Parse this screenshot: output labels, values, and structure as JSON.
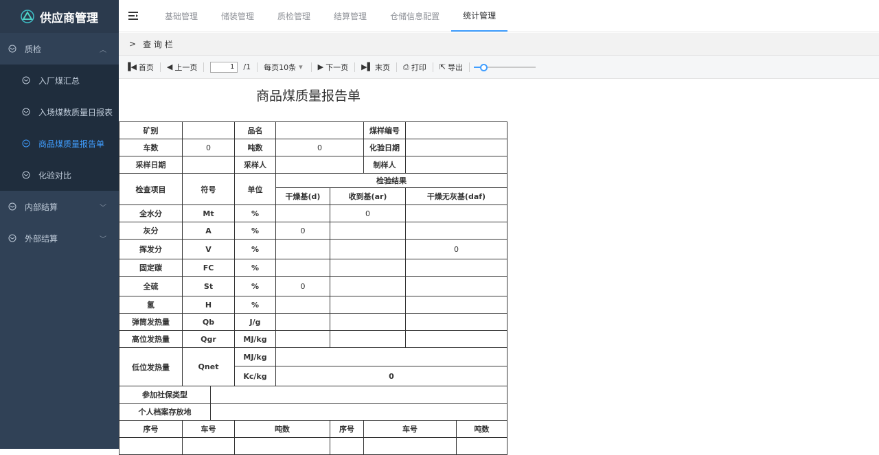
{
  "sidebar": {
    "app_title": "供应商管理",
    "groups": [
      {
        "label": "质检",
        "expanded": true,
        "items": [
          {
            "label": "入厂煤汇总"
          },
          {
            "label": "入场煤数质量日报表"
          },
          {
            "label": "商品煤质量报告单",
            "active": true
          },
          {
            "label": "化验对比"
          }
        ]
      },
      {
        "label": "内部结算",
        "expanded": false
      },
      {
        "label": "外部结算",
        "expanded": false
      }
    ]
  },
  "topnav": {
    "items": [
      {
        "label": "基础管理"
      },
      {
        "label": "储装管理"
      },
      {
        "label": "质检管理"
      },
      {
        "label": "结算管理"
      },
      {
        "label": "仓储信息配置"
      },
      {
        "label": "统计管理",
        "active": true
      }
    ]
  },
  "querybar": {
    "label": "查 询 栏"
  },
  "toolbar": {
    "first": "首页",
    "prev": "上一页",
    "page_value": "1",
    "page_total": "/1",
    "per_page": "每页10条",
    "next": "下一页",
    "last": "末页",
    "print": "打印",
    "export": "导出"
  },
  "report": {
    "title": "商品煤质量报告单",
    "labels": {
      "mine": "矿别",
      "product": "品名",
      "sample_no": "煤样编号",
      "cars": "车数",
      "tons": "吨数",
      "test_date": "化验日期",
      "sample_date": "采样日期",
      "sampler": "采样人",
      "preparer": "制样人",
      "item": "检查项目",
      "symbol": "符号",
      "unit": "单位",
      "result": "检验结果",
      "dry": "干燥基(d)",
      "ar": "收到基(ar)",
      "daf": "干燥无灰基(daf)",
      "insurance": "参加社保类型",
      "archive": "个人档案存放地",
      "seq": "序号",
      "car_no": "车号",
      "tonnage": "吨数"
    },
    "values": {
      "cars": "0",
      "tons": "0"
    },
    "rows": [
      {
        "name": "全水分",
        "symbol": "Mt",
        "unit": "%",
        "d": "",
        "ar": "0",
        "daf": ""
      },
      {
        "name": "灰分",
        "symbol": "A",
        "unit": "%",
        "d": "0",
        "ar": "",
        "daf": ""
      },
      {
        "name": "挥发分",
        "symbol": "V",
        "unit": "%",
        "d": "",
        "ar": "",
        "daf": "0"
      },
      {
        "name": "固定碳",
        "symbol": "FC",
        "unit": "%",
        "d": "",
        "ar": "",
        "daf": ""
      },
      {
        "name": "全硫",
        "symbol": "St",
        "unit": "%",
        "d": "0",
        "ar": "",
        "daf": ""
      },
      {
        "name": "氢",
        "symbol": "H",
        "unit": "%",
        "d": "",
        "ar": "",
        "daf": ""
      },
      {
        "name": "弹筒发热量",
        "symbol": "Qb",
        "unit": "J/g",
        "d": "",
        "ar": "",
        "daf": ""
      },
      {
        "name": "高位发热量",
        "symbol": "Qgr",
        "unit": "MJ/kg",
        "d": "",
        "ar": "",
        "daf": ""
      }
    ],
    "qnet": {
      "name": "低位发热量",
      "symbol": "Qnet",
      "unit1": "MJ/kg",
      "val1": "",
      "unit2": "Kc/kg",
      "val2": "0"
    }
  }
}
